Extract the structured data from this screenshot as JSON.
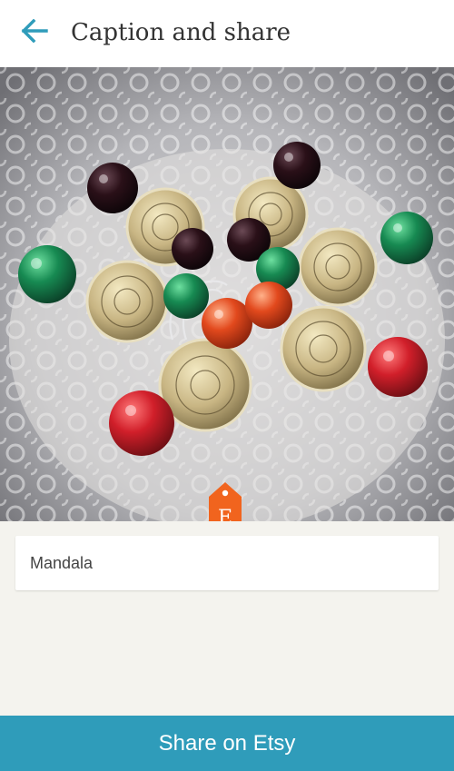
{
  "header": {
    "title": "Caption and share",
    "back_icon": "arrow-left-icon"
  },
  "photo": {
    "description_icon": "listing-photo",
    "tag": {
      "letter": "E",
      "icon": "etsy-tag-icon",
      "color": "#f1641e"
    }
  },
  "caption": {
    "value": "Mandala"
  },
  "footer": {
    "share_label": "Share on Etsy"
  },
  "colors": {
    "accent": "#2f9cba",
    "background": "#f4f3ee",
    "etsy_orange": "#f1641e"
  }
}
